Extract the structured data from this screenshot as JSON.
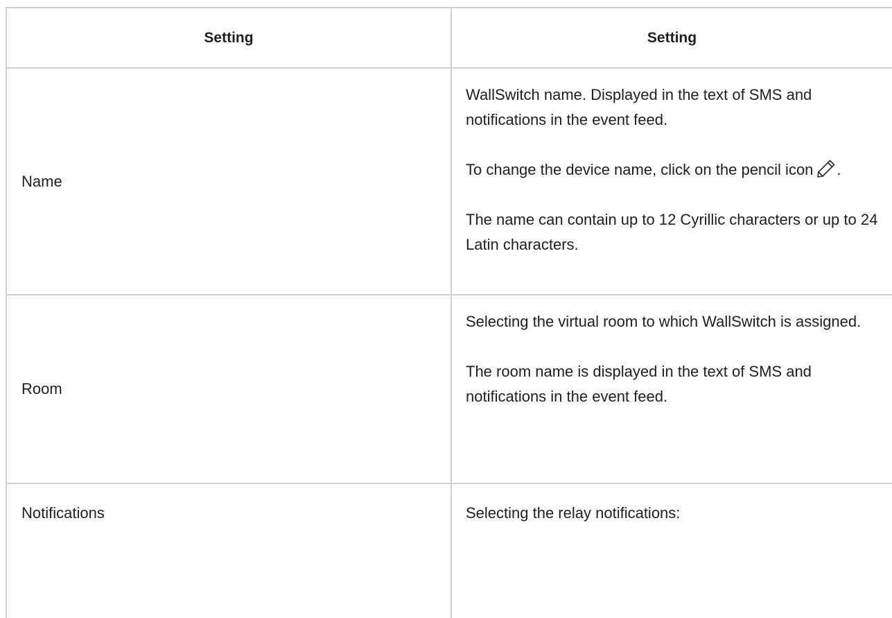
{
  "table": {
    "headers": [
      "Setting",
      "Setting"
    ],
    "rows": [
      {
        "name": "Name",
        "description": {
          "p1": "WallSwitch name. Displayed in the text of SMS and notifications in the event feed.",
          "p2_before_icon": "To change the device name, click on the pencil icon",
          "p2_icon": "pencil-icon",
          "p2_after_icon": ".",
          "p3": "The name can contain up to 12 Cyrillic characters or up to 24 Latin characters."
        }
      },
      {
        "name": "Room",
        "description": {
          "p1": "Selecting the virtual room to which WallSwitch is assigned.",
          "p2": "The room name is displayed in the text of SMS and notifications in the event feed."
        }
      },
      {
        "name": "Notifications",
        "description": {
          "p1": "Selecting the relay notifications:"
        }
      }
    ]
  },
  "colors": {
    "border": "#d2d2d2",
    "text": "#1f1f1f",
    "background": "#ffffff"
  }
}
